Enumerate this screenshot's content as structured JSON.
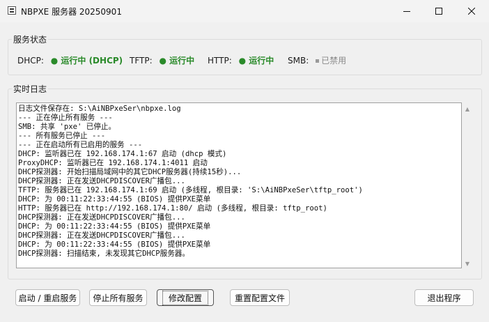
{
  "window": {
    "title": "NBPXE 服务器 20250901"
  },
  "status_group": {
    "label": "服务状态",
    "items": [
      {
        "name": "DHCP:",
        "value": "● 运行中 (DHCP)"
      },
      {
        "name": "TFTP:",
        "value": "● 运行中"
      },
      {
        "name": "HTTP:",
        "value": "● 运行中"
      },
      {
        "name": "SMB:",
        "value": "已禁用"
      }
    ]
  },
  "log_group": {
    "label": "实时日志",
    "lines": [
      "日志文件保存在: S:\\AiNBPxeSer\\nbpxe.log",
      "--- 正在停止所有服务 ---",
      "SMB: 共享 'pxe' 已停止。",
      "--- 所有服务已停止 ---",
      "--- 正在启动所有已启用的服务 ---",
      "DHCP: 监听器已在 192.168.174.1:67 启动 (dhcp 模式)",
      "ProxyDHCP: 监听器已在 192.168.174.1:4011 启动",
      "DHCP探测器: 开始扫描局域网中的其它DHCP服务器(持续15秒)...",
      "DHCP探测器: 正在发送DHCPDISCOVER广播包...",
      "TFTP: 服务器已在 192.168.174.1:69 启动 (多线程, 根目录: 'S:\\AiNBPxeSer\\tftp_root')",
      "DHCP: 为 00:11:22:33:44:55 (BIOS) 提供PXE菜单",
      "HTTP: 服务器已在 http://192.168.174.1:80/ 启动 (多线程, 根目录: tftp_root)",
      "DHCP探测器: 正在发送DHCPDISCOVER广播包...",
      "DHCP: 为 00:11:22:33:44:55 (BIOS) 提供PXE菜单",
      "DHCP探测器: 正在发送DHCPDISCOVER广播包...",
      "DHCP: 为 00:11:22:33:44:55 (BIOS) 提供PXE菜单",
      "DHCP探测器: 扫描结束, 未发现其它DHCP服务器。"
    ]
  },
  "buttons": {
    "start_restart": "启动 / 重启服务",
    "stop_all": "停止所有服务",
    "modify_config": "修改配置",
    "reset_config": "重置配置文件",
    "exit": "退出程序"
  },
  "colors": {
    "running": "#2a8a2a",
    "disabled": "#8a8a8a"
  }
}
